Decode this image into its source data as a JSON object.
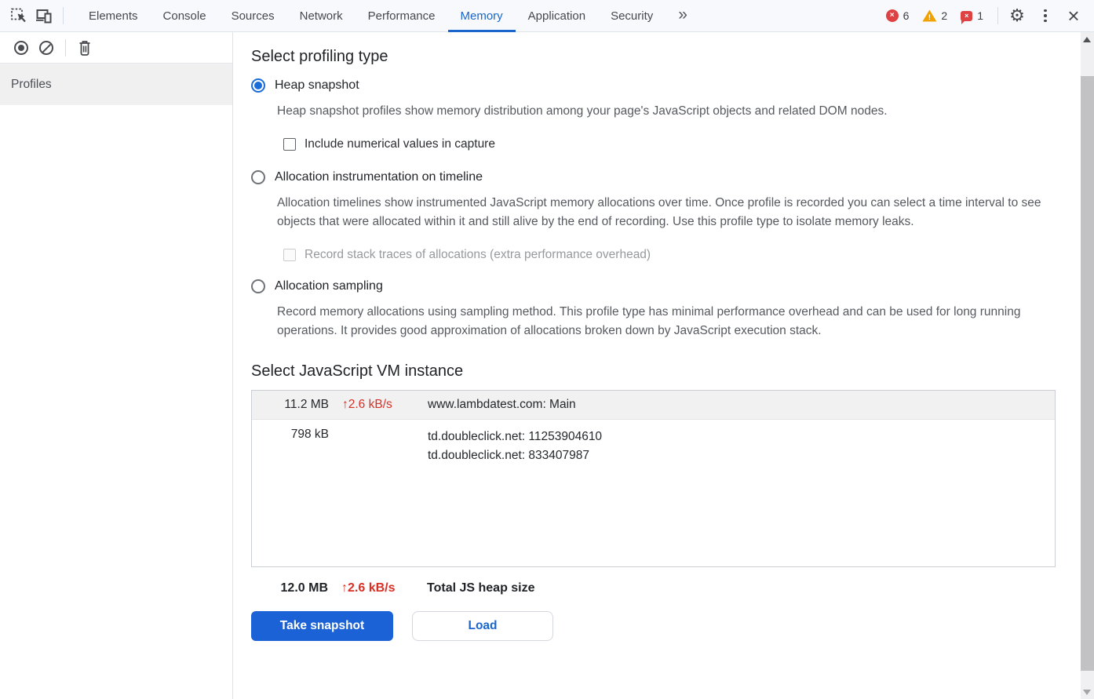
{
  "tabbar": {
    "tabs": [
      {
        "label": "Elements"
      },
      {
        "label": "Console"
      },
      {
        "label": "Sources"
      },
      {
        "label": "Network"
      },
      {
        "label": "Performance"
      },
      {
        "label": "Memory"
      },
      {
        "label": "Application"
      },
      {
        "label": "Security"
      }
    ],
    "active_tab": "Memory",
    "badges": {
      "errors": "6",
      "warnings": "2",
      "issues": "1"
    },
    "icons": {
      "overflow": "»",
      "error_mark": "×",
      "warning_mark": "!",
      "issue_mark": "×",
      "settings": "⚙",
      "close": "×"
    }
  },
  "sidebar": {
    "profiles_label": "Profiles"
  },
  "main": {
    "profiling_heading": "Select profiling type",
    "options": [
      {
        "label": "Heap snapshot",
        "description": "Heap snapshot profiles show memory distribution among your page's JavaScript objects and related DOM nodes.",
        "checkbox": "Include numerical values in capture"
      },
      {
        "label": "Allocation instrumentation on timeline",
        "description": "Allocation timelines show instrumented JavaScript memory allocations over time. Once profile is recorded you can select a time interval to see objects that were allocated within it and still alive by the end of recording. Use this profile type to isolate memory leaks.",
        "checkbox": "Record stack traces of allocations (extra performance overhead)"
      },
      {
        "label": "Allocation sampling",
        "description": "Record memory allocations using sampling method. This profile type has minimal performance overhead and can be used for long running operations. It provides good approximation of allocations broken down by JavaScript execution stack."
      }
    ],
    "vm_heading": "Select JavaScript VM instance",
    "vm_rows": [
      {
        "size": "11.2 MB",
        "rate": "↑2.6 kB/s",
        "names": [
          "www.lambdatest.com: Main"
        ]
      },
      {
        "size": "798 kB",
        "rate": "",
        "names": [
          "td.doubleclick.net: 11253904610",
          "td.doubleclick.net: 833407987"
        ]
      }
    ],
    "total": {
      "size": "12.0 MB",
      "rate": "↑2.6 kB/s",
      "label": "Total JS heap size"
    },
    "buttons": {
      "take_snapshot": "Take snapshot",
      "load": "Load"
    }
  },
  "colors": {
    "accent_blue": "#1a66cc",
    "button_blue": "#1b62d6",
    "error_red": "#df4242",
    "warning_orange": "#f0a300",
    "rate_red": "#d93025"
  }
}
